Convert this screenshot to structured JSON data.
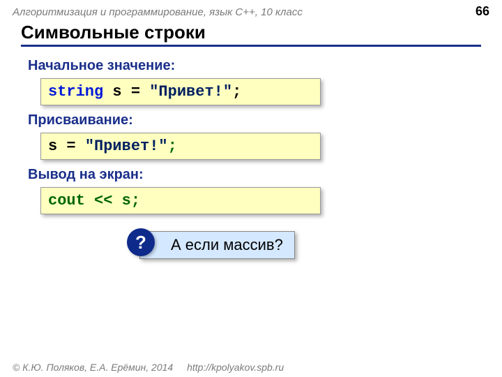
{
  "header": {
    "course": "Алгоритмизация и программирование, язык C++, 10 класс",
    "page_number": "66"
  },
  "title": "Символьные строки",
  "sections": {
    "init": {
      "label": "Начальное значение:",
      "code": {
        "kw": "string",
        "var": " s = ",
        "str": "\"Привет!\"",
        "semi": ";"
      }
    },
    "assign": {
      "label": "Присваивание:",
      "code": {
        "lhs": "s = ",
        "str": "\"Привет!\"",
        "semi": ";"
      }
    },
    "output": {
      "label": "Вывод на экран:",
      "code": {
        "full": "cout << s;"
      }
    }
  },
  "question": {
    "mark": "?",
    "text": "А если массив?"
  },
  "footer": {
    "copyright": "© К.Ю. Поляков, Е.А. Ерёмин, 2014",
    "url": "http://kpolyakov.spb.ru"
  }
}
